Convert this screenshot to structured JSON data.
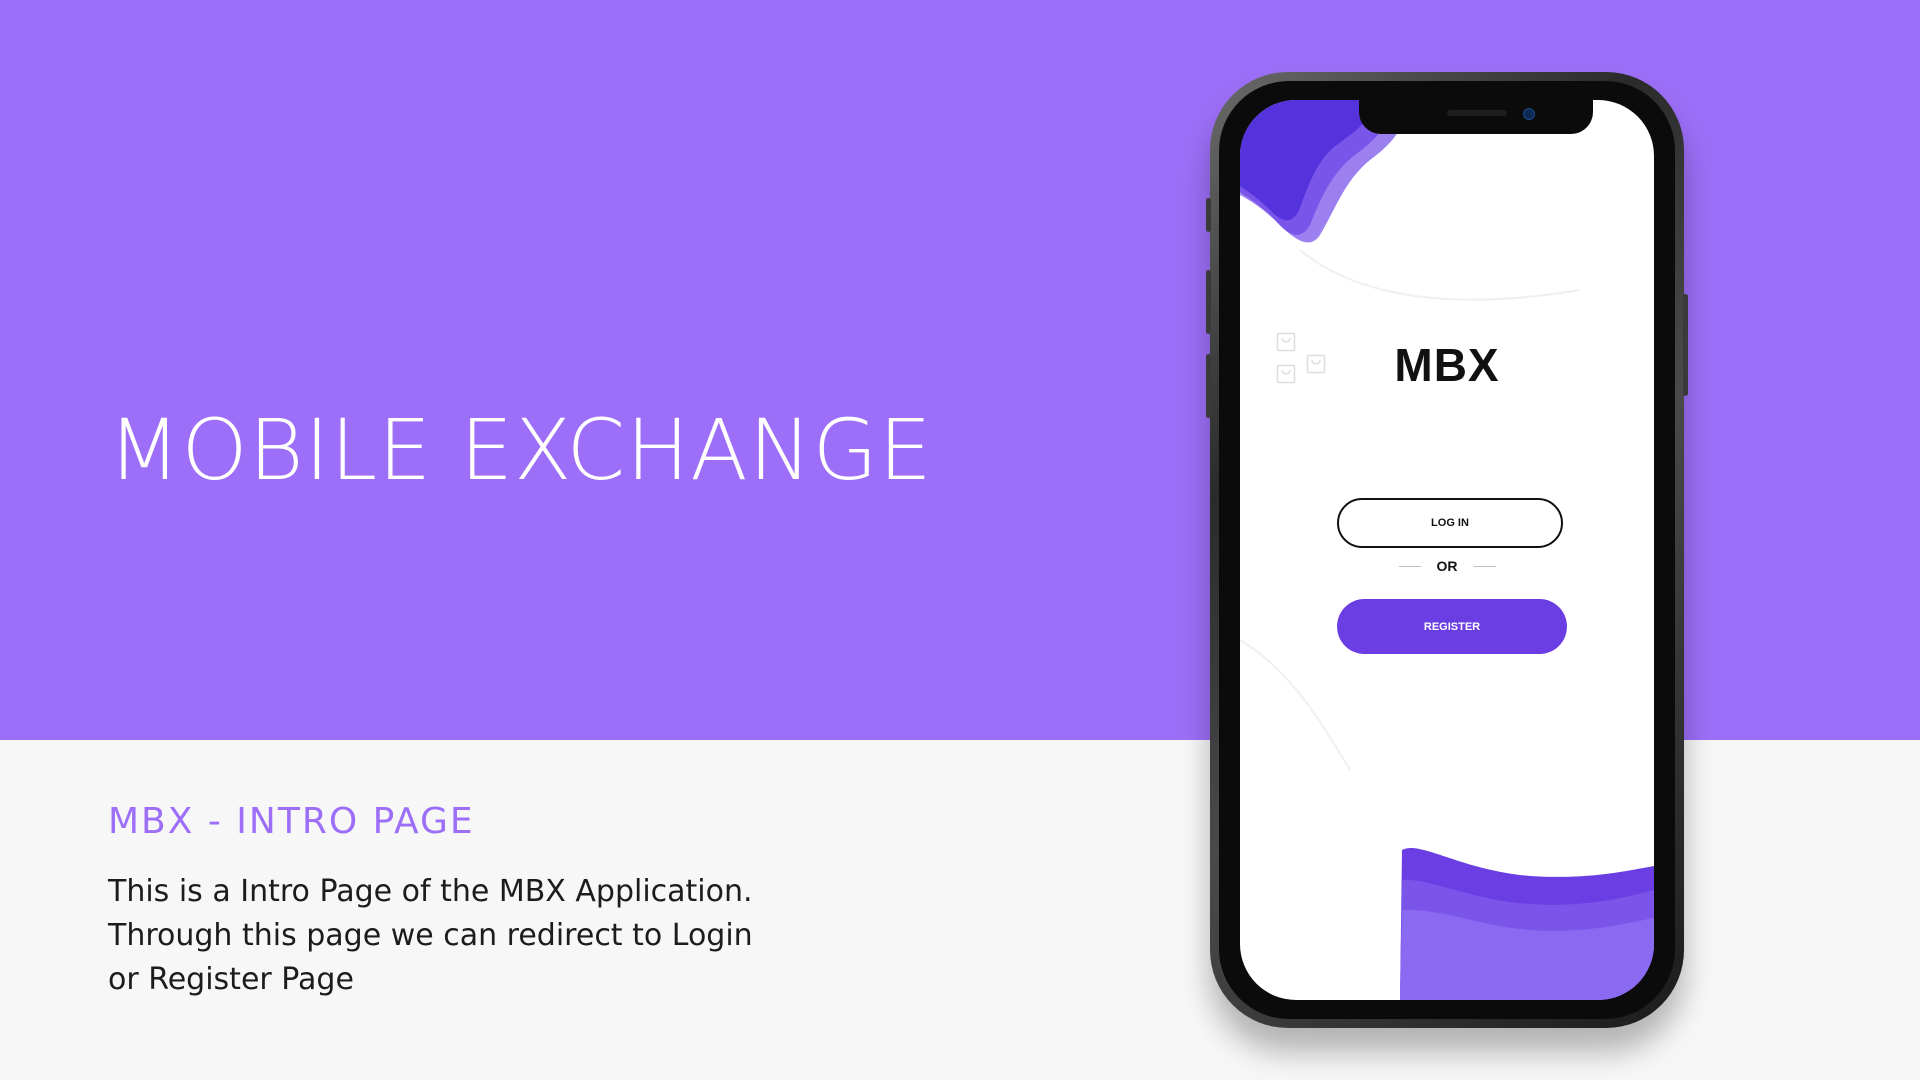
{
  "slide": {
    "title": "MOBILE EXCHANGE",
    "section_heading": "MBX - INTRO PAGE",
    "description_lines": [
      "This is a Intro Page of the MBX Application.",
      "Through this page we can redirect to Login",
      "or Register Page"
    ]
  },
  "app": {
    "brand": "MBX",
    "login_label": "LOG IN",
    "or_label": "OR",
    "register_label": "REGISTER"
  },
  "icons": {
    "decor": "shopping-bag-icon"
  },
  "colors": {
    "hero_background": "#9d6ff8",
    "bottom_background": "#f7f7f7",
    "accent": "#6a3ee3",
    "heading": "#9d6ff8"
  }
}
